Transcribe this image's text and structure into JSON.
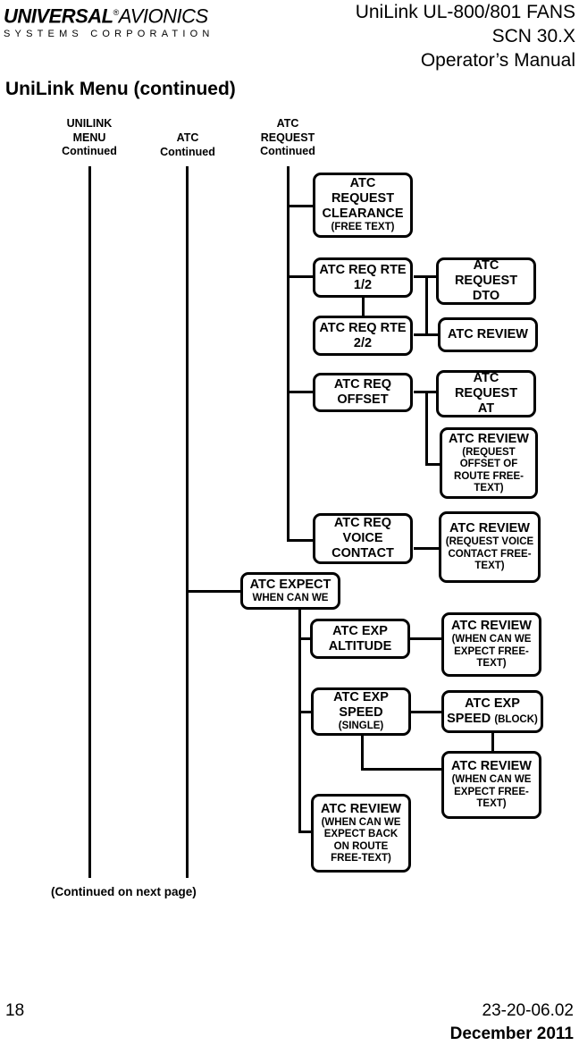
{
  "header": {
    "logo_line1_bold": "UNIVERSAL",
    "logo_registered": "®",
    "logo_line1_light": "AVIONICS",
    "logo_line2": "SYSTEMS CORPORATION",
    "doc_title_line1": "UniLink UL-800/801 FANS",
    "doc_title_line2": "SCN 30.X",
    "doc_title_line3": "Operator’s Manual",
    "page_heading": "UniLink Menu (continued)"
  },
  "diagram": {
    "columns": [
      {
        "label": "UNILINK\nMENU\nContinued"
      },
      {
        "label": "ATC\nContinued"
      },
      {
        "label": "ATC\nREQUEST\nContinued"
      }
    ],
    "nodes": [
      {
        "id": "atc-request-clearance",
        "title": "ATC\nREQUEST\nCLEARANCE",
        "subtitle": "(FREE TEXT)"
      },
      {
        "id": "atc-req-rte-1-2",
        "title": "ATC REQ RTE\n1/2",
        "subtitle": ""
      },
      {
        "id": "atc-request-dto",
        "title": "ATC\nREQUEST\nDTO",
        "subtitle": ""
      },
      {
        "id": "atc-req-rte-2-2",
        "title": "ATC REQ RTE\n2/2",
        "subtitle": ""
      },
      {
        "id": "atc-review-rte",
        "title": "ATC REVIEW",
        "subtitle": ""
      },
      {
        "id": "atc-req-offset",
        "title": "ATC REQ\nOFFSET",
        "subtitle": ""
      },
      {
        "id": "atc-request-at",
        "title": "ATC\nREQUEST\nAT",
        "subtitle": ""
      },
      {
        "id": "atc-review-offset",
        "title": "ATC REVIEW",
        "subtitle": "(REQUEST\nOFFSET OF\nROUTE  FREE-\nTEXT)"
      },
      {
        "id": "atc-req-voice-contact",
        "title": "ATC REQ\nVOICE\nCONTACT",
        "subtitle": ""
      },
      {
        "id": "atc-review-voice",
        "title": "ATC REVIEW",
        "subtitle": "(REQUEST VOICE\nCONTACT  FREE-\nTEXT)"
      },
      {
        "id": "atc-expect",
        "title": "ATC EXPECT",
        "subtitle": "WHEN CAN WE"
      },
      {
        "id": "atc-exp-altitude",
        "title": "ATC EXP\nALTITUDE",
        "subtitle": ""
      },
      {
        "id": "atc-review-altitude",
        "title": "ATC REVIEW",
        "subtitle": "(WHEN CAN WE\nEXPECT   FREE-\nTEXT)"
      },
      {
        "id": "atc-exp-speed-single",
        "title": "ATC EXP\nSPEED",
        "subtitle": "(SINGLE)"
      },
      {
        "id": "atc-exp-speed-block",
        "title": "ATC EXP",
        "title2": "SPEED",
        "inline_sub": "(BLOCK)",
        "subtitle": ""
      },
      {
        "id": "atc-review-speed",
        "title": "ATC REVIEW",
        "subtitle": "(WHEN CAN WE\nEXPECT   FREE-\nTEXT)"
      },
      {
        "id": "atc-review-back-on-route",
        "title": "ATC REVIEW",
        "subtitle": "(WHEN CAN WE\nEXPECT BACK\nON ROUTE\nFREE-TEXT)"
      }
    ],
    "continued_note": "(Continued on next page)"
  },
  "footer": {
    "page_number": "18",
    "document_number": "23-20-06.02",
    "date": "December 2011"
  },
  "colors": {
    "ink": "#000000",
    "paper": "#ffffff"
  }
}
